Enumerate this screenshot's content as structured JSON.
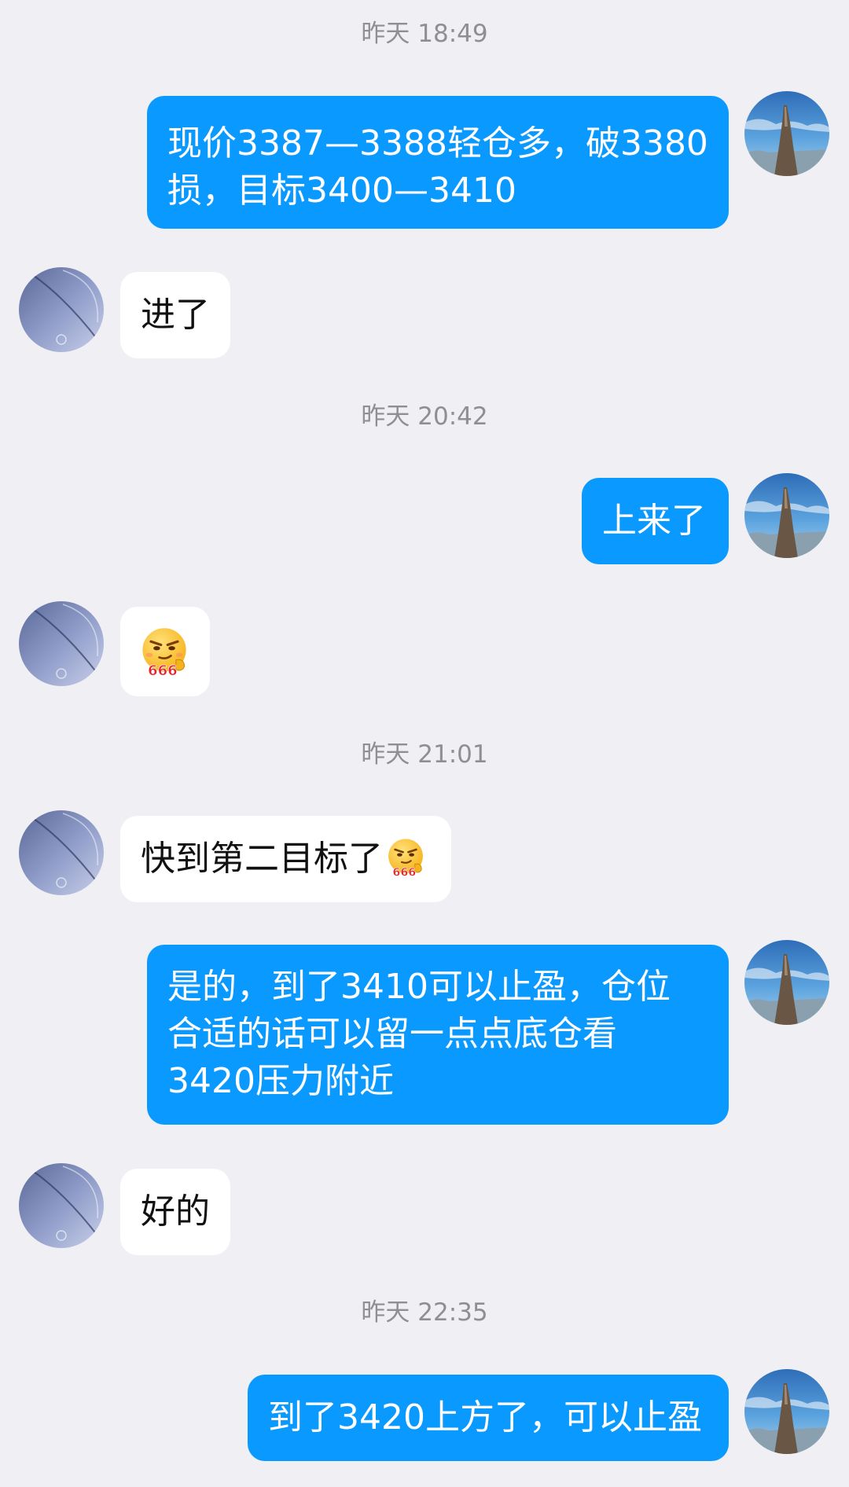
{
  "messages": {
    "ts1": "昨天 18:49",
    "m1_line1": "现价3387—3388轻仓多，破3380",
    "m1_line2": "损，目标3400—3410",
    "m2": "进了",
    "ts2": "昨天 20:42",
    "m3": "上来了",
    "sticker1": "666",
    "ts3": "昨天 21:01",
    "m5": "快到第二目标了",
    "sticker2": "666",
    "m6_line1": "是的，到了3410可以止盈，仓位",
    "m6_line2": "合适的话可以留一点点底仓看",
    "m6_line3": "3420压力附近",
    "m7": "好的",
    "ts4": "昨天 22:35",
    "m8": "到了3420上方了，可以止盈"
  },
  "icons": {
    "self_avatar": "mountain-sky-avatar",
    "contact_avatar": "gradient-circle-avatar",
    "emoji": "smirk-666-emoji"
  },
  "colors": {
    "background": "#EFEFF4",
    "outgoing_bubble": "#0A99FF",
    "incoming_bubble": "#FFFFFF",
    "timestamp": "#8E8E93"
  }
}
